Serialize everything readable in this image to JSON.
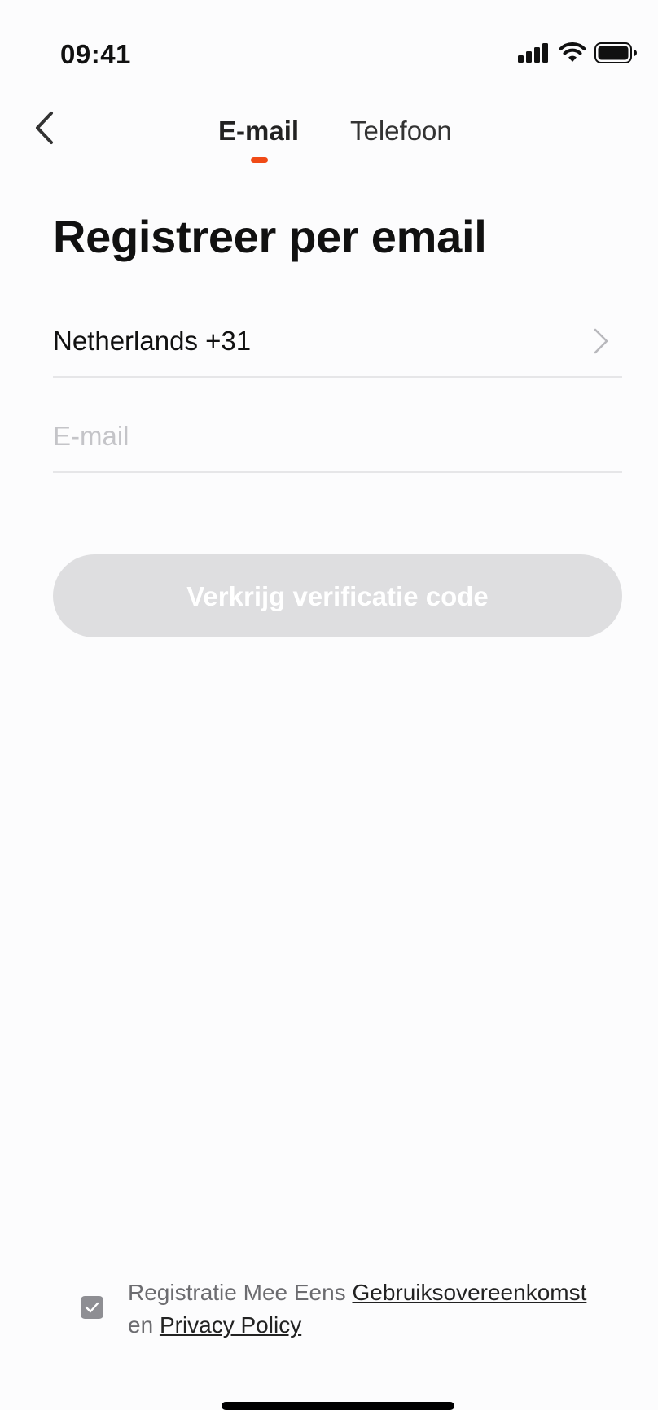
{
  "status": {
    "time": "09:41"
  },
  "tabs": {
    "email_label": "E-mail",
    "phone_label": "Telefoon",
    "active": "E-mail"
  },
  "title": "Registreer per email",
  "country": {
    "label": "Netherlands +31"
  },
  "email": {
    "placeholder": "E-mail",
    "value": ""
  },
  "submit": {
    "label": "Verkrijg verificatie code"
  },
  "agreement": {
    "checked": true,
    "prefix": "Registratie Mee Eens",
    "terms_link": "Gebruiksovereenkomst",
    "middle": "en",
    "privacy_link": "Privacy Policy"
  },
  "colors": {
    "accent": "#f04a16",
    "button_disabled": "#dedee0",
    "checkbox": "#8e8e93"
  },
  "icons": [
    "signal-icon",
    "wifi-icon",
    "battery-icon",
    "back-chevron-icon",
    "chevron-right-icon",
    "check-icon"
  ]
}
